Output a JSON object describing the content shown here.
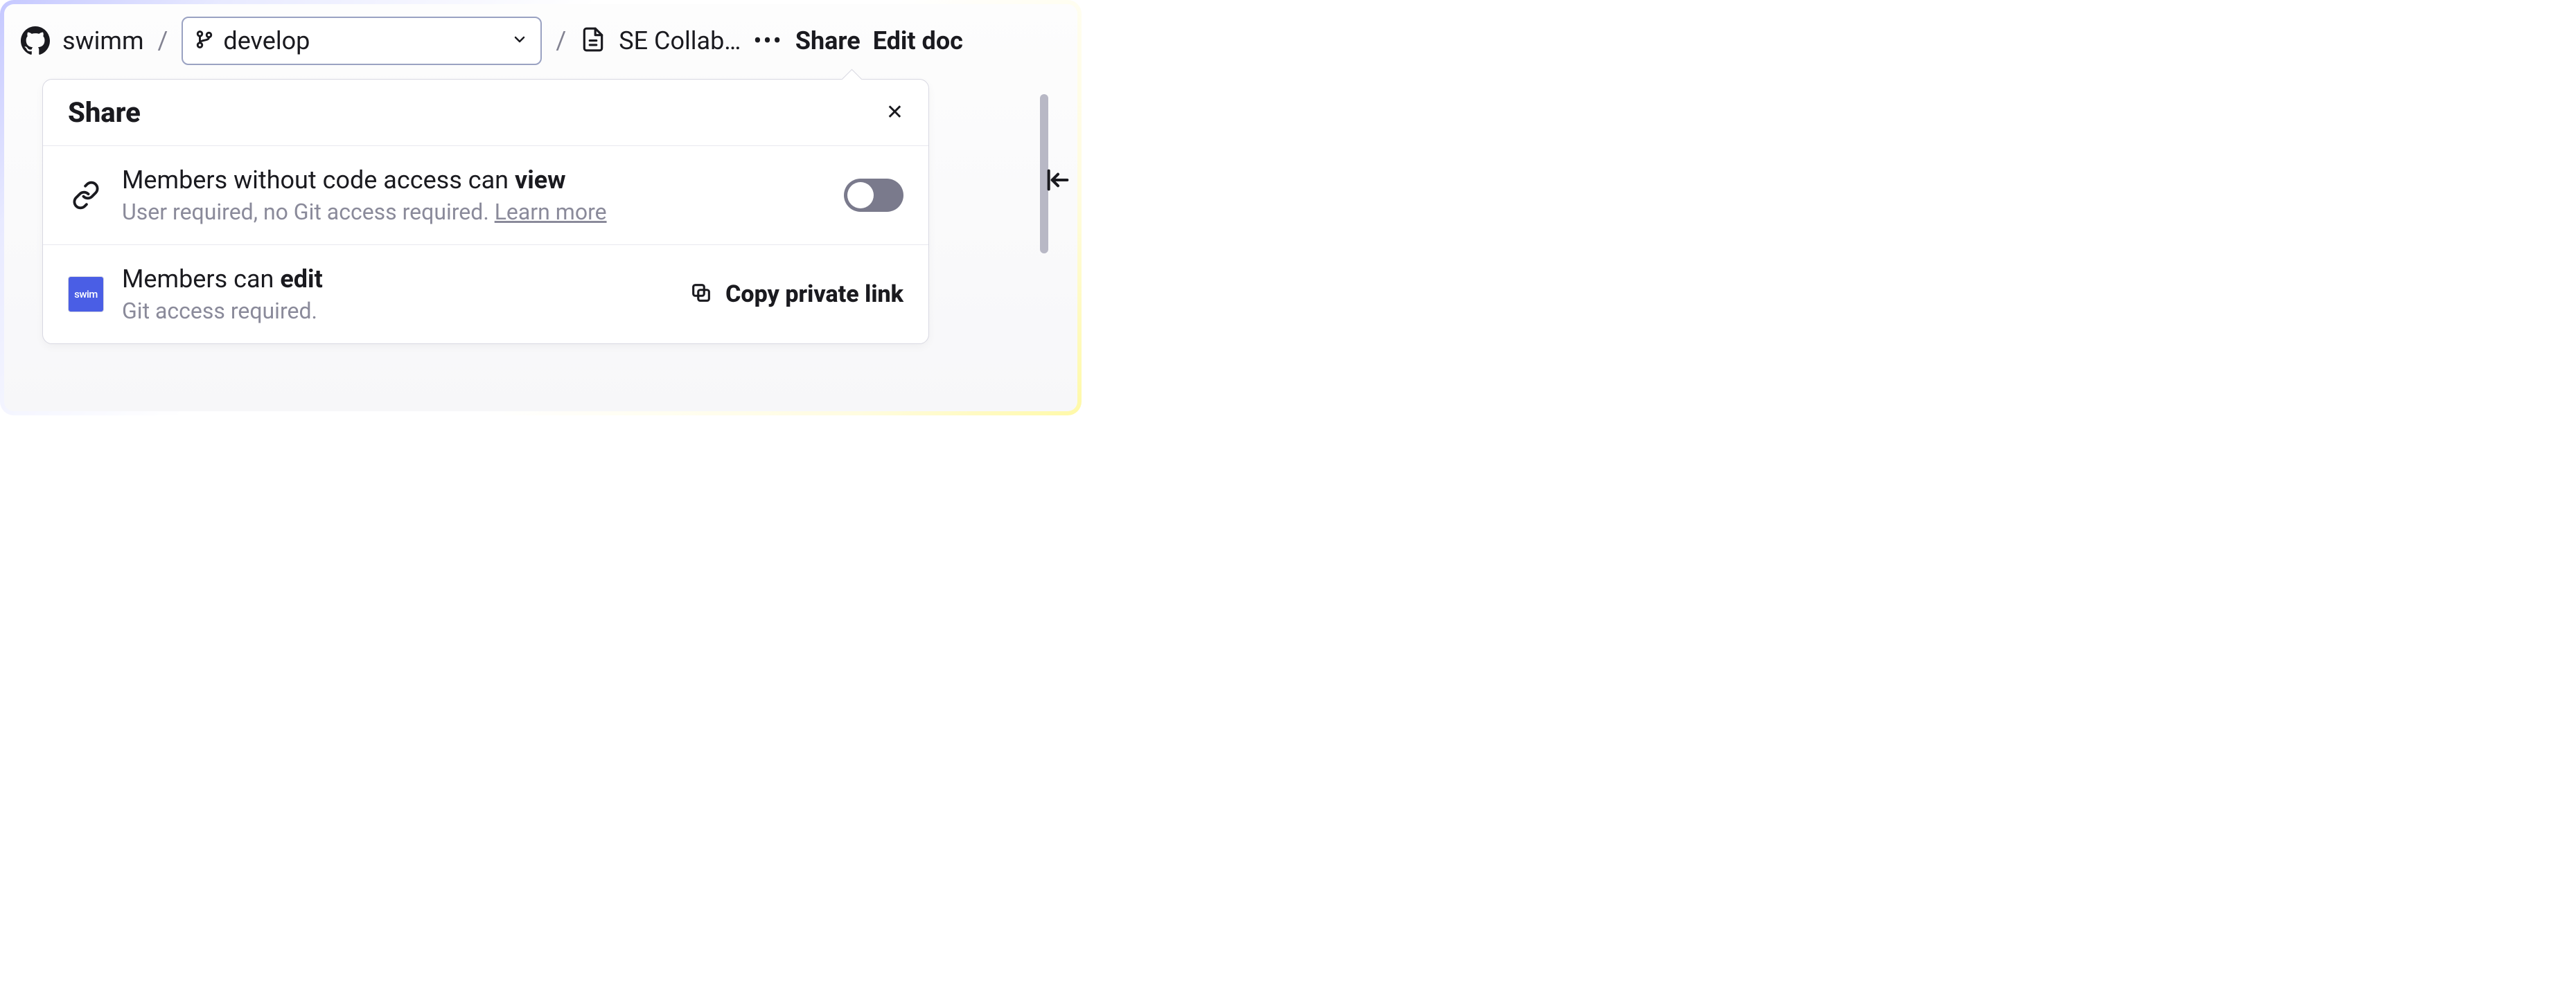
{
  "breadcrumb": {
    "repo": "swimm",
    "branch": "develop",
    "doc_title": "SE Collab…"
  },
  "topbar": {
    "share_label": "Share",
    "edit_label": "Edit doc"
  },
  "popover": {
    "title": "Share",
    "row_view": {
      "title_prefix": "Members without code access can ",
      "title_bold": "view",
      "subtitle_text": "User required, no Git access required. ",
      "learn_more": "Learn more"
    },
    "row_edit": {
      "logo_text": "swim",
      "title_prefix": "Members can ",
      "title_bold": "edit",
      "subtitle": "Git access required.",
      "copy_label": "Copy private link"
    }
  }
}
